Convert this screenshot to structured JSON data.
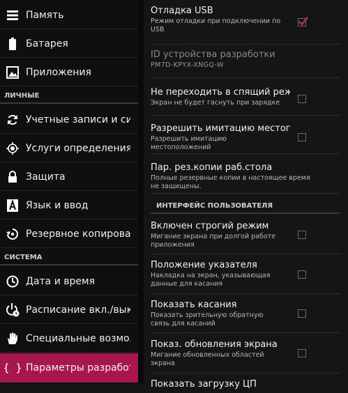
{
  "sidebar": {
    "items": [
      {
        "label": "Память",
        "icon": "storage-icon"
      },
      {
        "label": "Батарея",
        "icon": "battery-icon"
      },
      {
        "label": "Приложения",
        "icon": "apps-icon"
      },
      {
        "label": "Учетные записи и синхр",
        "icon": "sync-icon"
      },
      {
        "label": "Услуги определения ме",
        "icon": "location-icon"
      },
      {
        "label": "Защита",
        "icon": "lock-icon"
      },
      {
        "label": "Язык и ввод",
        "icon": "keyboard-icon"
      },
      {
        "label": "Резервное копирование",
        "icon": "backup-icon"
      },
      {
        "label": "Дата и время",
        "icon": "clock-icon"
      },
      {
        "label": "Расписание вкл./выкл.",
        "icon": "schedule-power-icon"
      },
      {
        "label": "Специальные возможн",
        "icon": "accessibility-hand-icon"
      },
      {
        "label": "Параметры разработчи",
        "icon": "developer-braces-icon"
      }
    ],
    "section_personal": "ЛИЧНЫЕ",
    "section_system": "СИСТЕМА",
    "active_color": "#a8164e"
  },
  "main": {
    "usb_debug": {
      "title": "Отладка USB",
      "sub": "Режим отладки при подключении по USB",
      "checked": true
    },
    "device_id": {
      "title": "ID устройства разработки",
      "sub": "PM7D-KPYX-XNGQ-W"
    },
    "stay_awake": {
      "title": "Не переходить в спящий режим",
      "sub": "Экран не будет гаснуть при зарядке",
      "checked": false
    },
    "mock_location": {
      "title": "Разрешить имитацию местоположений",
      "sub": "Разрешить имитацию местоположений",
      "checked": false
    },
    "backup_password": {
      "title": "Пар. рез.копии раб.стола",
      "sub": "Полные резервные копии в настоящее время не защищены."
    },
    "section_ui": "ИНТЕРФЕЙС ПОЛЬЗОВАТЕЛЯ",
    "strict_mode": {
      "title": "Включен строгий режим",
      "sub": "Мигание экрана при долгой работе приложения",
      "checked": false
    },
    "pointer_location": {
      "title": "Положение указателя",
      "sub": "Накладка на экран, указывающая данные для касания",
      "checked": false
    },
    "show_touches": {
      "title": "Показать касания",
      "sub": "Показать зрительную обратную связь для касаний",
      "checked": false
    },
    "show_updates": {
      "title": "Показ. обновления экрана",
      "sub": "Мигание обновленных областей экрана",
      "checked": false
    },
    "cpu_load": {
      "title": "Показать загрузку ЦП"
    }
  },
  "colors": {
    "check_mark": "#c8275f"
  }
}
